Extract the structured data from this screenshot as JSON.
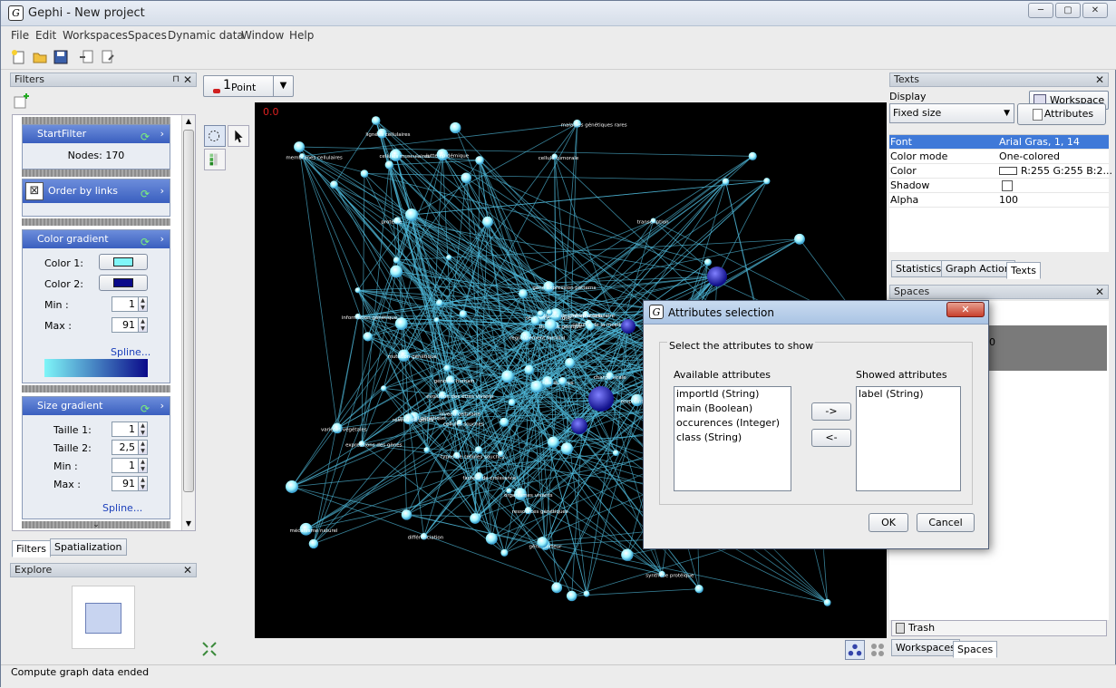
{
  "window": {
    "title": "Gephi - New project",
    "app_icon": "G"
  },
  "menu": [
    "File",
    "Edit",
    "Workspaces",
    "Spaces",
    "Dynamic data",
    "Window",
    "Help"
  ],
  "toolbar": {
    "workspace_label": "Workspace 1"
  },
  "filters_panel": {
    "title": "Filters",
    "start_filter": {
      "title": "StartFilter",
      "nodes_label": "Nodes: 170"
    },
    "order_by_links": {
      "title": "Order by links"
    },
    "color_gradient": {
      "title": "Color gradient",
      "color1_label": "Color 1:",
      "color1": "#7ff6f8",
      "color2_label": "Color 2:",
      "color2": "#0a0a8a",
      "min_label": "Min :",
      "min_value": "1",
      "max_label": "Max :",
      "max_value": "91",
      "spline_label": "Spline..."
    },
    "size_gradient": {
      "title": "Size gradient",
      "taille1_label": "Taille 1:",
      "taille1_value": "1",
      "taille2_label": "Taille 2:",
      "taille2_value": "2,5",
      "min_label": "Min :",
      "min_value": "1",
      "max_label": "Max :",
      "max_value": "91",
      "spline_label": "Spline..."
    },
    "tabs": [
      "Filters",
      "Spatialization"
    ]
  },
  "explore_panel": {
    "title": "Explore"
  },
  "graph_view": {
    "point_label": "Point",
    "point_size": "1",
    "counter": "0.0",
    "node_labels": [
      "cellules de la moelle",
      "lutte épidémique",
      "contrôle du virus",
      "typos de cellules souches",
      "facteur de croissance",
      "mécanisme naturel",
      "différenciation",
      "niveau cellulaire",
      "thérapie cellulaire",
      "regroupement familial",
      "cellules musculaires",
      "thérapie génique",
      "gène porteur",
      "information génétique",
      "matériel génétique",
      "code génétique",
      "séquence génique",
      "expressions des gènes",
      "organismes vivants",
      "êtres vivants",
      "évolution des êtres vivants",
      "réseau de gènes",
      "maladies génétiques rares",
      "collecte des informations",
      "gestion des ressources",
      "ressources génétiques",
      "variétés végétales",
      "petites molécules",
      "membranes cellulaires",
      "synthèse protéique",
      "génome humain",
      "protéine",
      "transcription",
      "cellules souches",
      "gène expression patterns",
      "empreinte génétique",
      "charge virale",
      "cellule tumorale",
      "lignées cellulaires",
      "mutation génétique"
    ]
  },
  "texts_panel": {
    "title": "Texts",
    "display_label": "Display",
    "display_value": "Fixed size",
    "attributes_button": "Attributes",
    "properties": [
      {
        "name": "Font",
        "value": "Arial Gras, 1, 14"
      },
      {
        "name": "Color mode",
        "value": "One-colored"
      },
      {
        "name": "Color",
        "value": "R:255 G:255 B:2..."
      },
      {
        "name": "Shadow",
        "value": ""
      },
      {
        "name": "Alpha",
        "value": "100"
      }
    ],
    "tabs": [
      "Statistics",
      "Graph Action",
      "Texts"
    ]
  },
  "spaces_panel": {
    "title": "Spaces",
    "item_value": "0",
    "trash_label": "Trash",
    "tabs": [
      "Workspaces",
      "Spaces"
    ]
  },
  "dialog": {
    "title": "Attributes selection",
    "group_label": "Select the attributes to show",
    "available_label": "Available attributes",
    "showed_label": "Showed attributes",
    "available": [
      "importId (String)",
      "main (Boolean)",
      "occurences (Integer)",
      "class (String)"
    ],
    "showed": [
      "label (String)"
    ],
    "add_button": "->",
    "remove_button": "<-",
    "ok_button": "OK",
    "cancel_button": "Cancel"
  },
  "status": {
    "text": "Compute graph data ended"
  }
}
